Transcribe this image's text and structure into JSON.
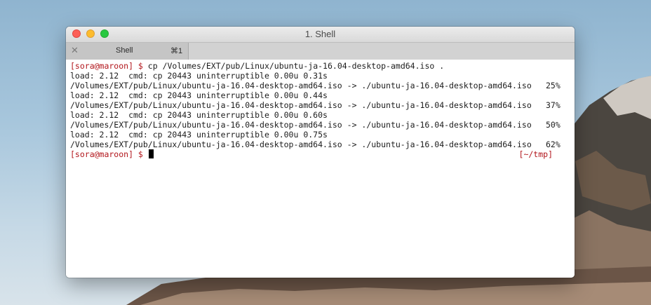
{
  "window": {
    "title": "1. Shell"
  },
  "tab": {
    "close_glyph": "✕",
    "label": "Shell",
    "shortcut": "⌘1"
  },
  "terminal": {
    "prompt": "[sora@maroon] $",
    "command": "cp /Volumes/EXT/pub/Linux/ubuntu-ja-16.04-desktop-amd64.iso .",
    "entries": [
      {
        "load": "load: 2.12  cmd: cp 20443 uninterruptible 0.00u 0.31s",
        "copy": "/Volumes/EXT/pub/Linux/ubuntu-ja-16.04-desktop-amd64.iso -> ./ubuntu-ja-16.04-desktop-amd64.iso",
        "percent": "25%"
      },
      {
        "load": "load: 2.12  cmd: cp 20443 uninterruptible 0.00u 0.44s",
        "copy": "/Volumes/EXT/pub/Linux/ubuntu-ja-16.04-desktop-amd64.iso -> ./ubuntu-ja-16.04-desktop-amd64.iso",
        "percent": "37%"
      },
      {
        "load": "load: 2.12  cmd: cp 20443 uninterruptible 0.00u 0.60s",
        "copy": "/Volumes/EXT/pub/Linux/ubuntu-ja-16.04-desktop-amd64.iso -> ./ubuntu-ja-16.04-desktop-amd64.iso",
        "percent": "50%"
      },
      {
        "load": "load: 2.12  cmd: cp 20443 uninterruptible 0.00u 0.75s",
        "copy": "/Volumes/EXT/pub/Linux/ubuntu-ja-16.04-desktop-amd64.iso -> ./ubuntu-ja-16.04-desktop-amd64.iso",
        "percent": "62%"
      }
    ],
    "right_prompt": "[~/tmp]"
  },
  "colors": {
    "prompt": "#b2161c",
    "text": "#1c1c1c",
    "background": "#ffffff"
  }
}
